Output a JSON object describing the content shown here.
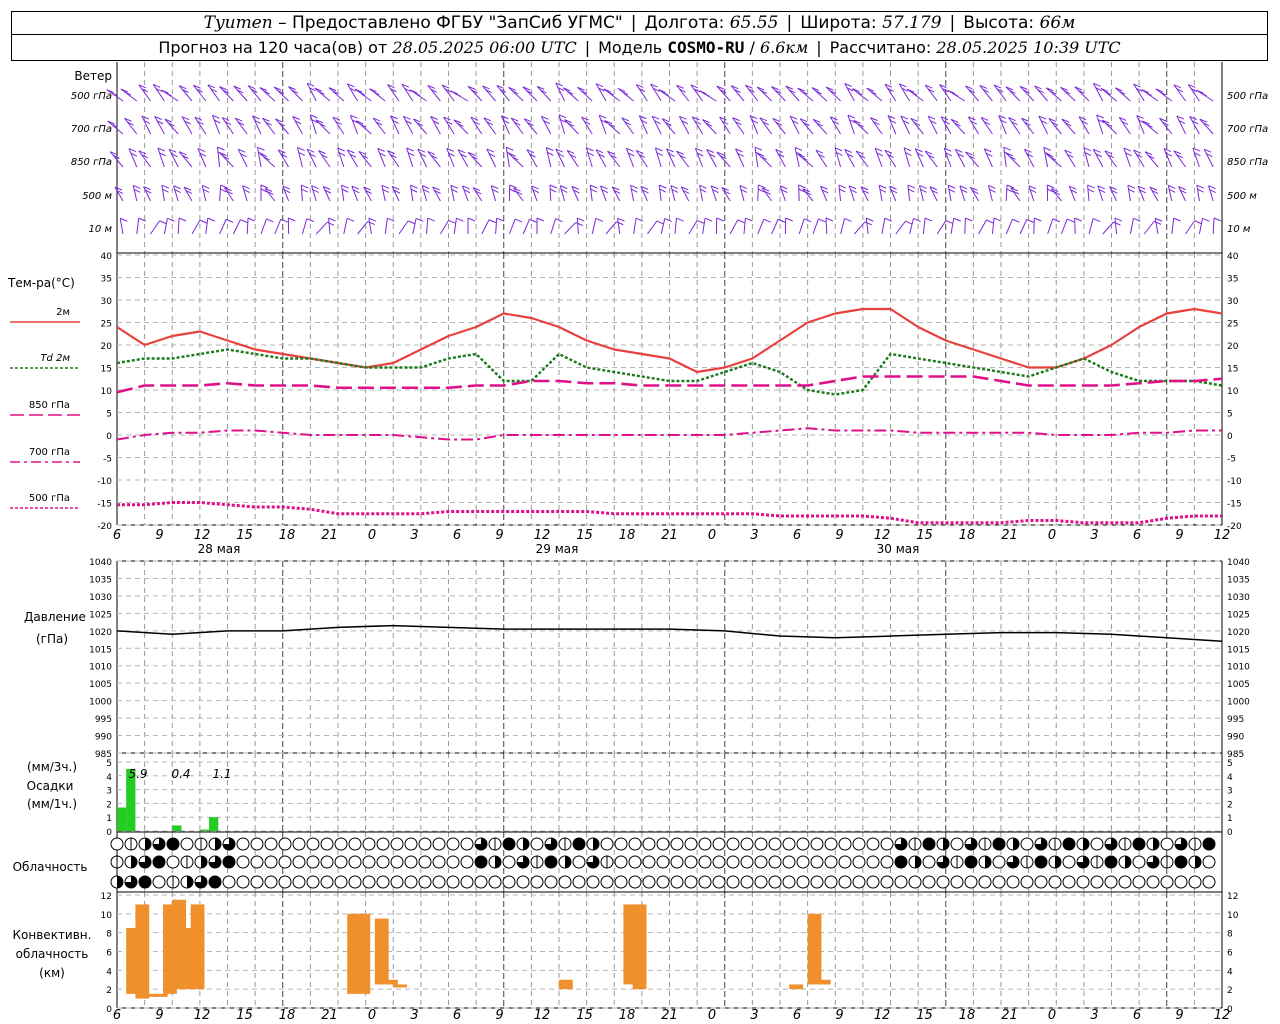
{
  "header": {
    "station": "Tyumen",
    "dash": "–",
    "provider": "Предоставлено ФГБУ \"ЗапСиб УГМС\"",
    "lon_label": "Долгота:",
    "lon": "65.55",
    "lat_label": "Широта:",
    "lat": "57.179",
    "alt_label": "Высота:",
    "alt": "66м",
    "forecast_label": "Прогноз на 120 часа(ов) от",
    "forecast_start": "28.05.2025 06:00 UTC",
    "model_label": "Модель",
    "model": "COSMO-RU",
    "model_res": "6.6км",
    "computed_label": "Рассчитано:",
    "computed": "28.05.2025 10:39 UTC"
  },
  "panels": {
    "wind": {
      "title": "Ветер",
      "levels": [
        "500 гПа",
        "700 гПа",
        "850 гПа",
        "500 м",
        "10 м"
      ],
      "right_levels": [
        "500 гПа",
        "700 гПа",
        "850 гПа",
        "500 м",
        "10 м"
      ]
    },
    "temp": {
      "title": "Тем-ра(°С)",
      "legend": [
        "2м",
        "Td 2м",
        "850 гПа",
        "700 гПа",
        "500 гПа"
      ]
    },
    "pressure": {
      "title1": "Давление",
      "title2": "(гПа)"
    },
    "precip": {
      "title1": "(мм/3ч.)",
      "title2": "Осадки",
      "title3": "(мм/1ч.)",
      "totals": [
        "5.9",
        "0.4",
        "1.1"
      ]
    },
    "cloud": {
      "title": "Облачность"
    },
    "conv": {
      "title1": "Конвективн.",
      "title2": "облачность",
      "title3": "(км)"
    }
  },
  "axis": {
    "hour_labels": [
      "6",
      "9",
      "12",
      "15",
      "18",
      "21",
      "0",
      "3",
      "6",
      "9",
      "12",
      "15",
      "18",
      "21",
      "0",
      "3",
      "6",
      "9",
      "12",
      "15",
      "18",
      "21",
      "0",
      "3",
      "6",
      "9",
      "12"
    ],
    "date_labels": [
      "28 мая",
      "29 мая",
      "30 мая"
    ]
  },
  "colors": {
    "t2m": "#e8413c",
    "td2m": "#1b7a1b",
    "t850": "#e0108a",
    "t700": "#e0108a",
    "t500": "#e0108a",
    "wind": "#7a2ad8",
    "pressure": "#000000",
    "precip": "#22cc22",
    "conv": "#f0902c"
  },
  "chart_data": [
    {
      "type": "line",
      "panel": "temperature",
      "x_hours": [
        0,
        3,
        6,
        9,
        12,
        15,
        18,
        21,
        24,
        27,
        30,
        33,
        36,
        39,
        42,
        45,
        48,
        51,
        54,
        57,
        60,
        63,
        66,
        69,
        72,
        75,
        78,
        81,
        84,
        87,
        90,
        93,
        96,
        99,
        102,
        105,
        108,
        111,
        114,
        117,
        120
      ],
      "series": [
        {
          "name": "2м",
          "values": [
            24,
            20,
            22,
            23,
            21,
            19,
            18,
            17,
            16,
            15,
            16,
            19,
            22,
            24,
            27,
            26,
            24,
            21,
            19,
            18,
            17,
            14,
            15,
            17,
            21,
            25,
            27,
            28,
            28,
            24,
            21,
            19,
            17,
            15,
            15,
            17,
            20,
            24,
            27,
            28,
            27
          ]
        },
        {
          "name": "Td 2м",
          "values": [
            16,
            17,
            17,
            18,
            19,
            18,
            17,
            17,
            16,
            15,
            15,
            15,
            17,
            18,
            12,
            12,
            18,
            15,
            14,
            13,
            12,
            12,
            14,
            16,
            14,
            10,
            9,
            10,
            18,
            17,
            16,
            15,
            14,
            13,
            15,
            17,
            14,
            12,
            12,
            12,
            11
          ]
        },
        {
          "name": "850 гПа",
          "values": [
            9.5,
            11,
            11,
            11,
            11.5,
            11,
            11,
            11,
            10.5,
            10.5,
            10.5,
            10.5,
            10.5,
            11,
            11,
            12,
            12,
            11.5,
            11.5,
            11,
            11,
            11,
            11,
            11,
            11,
            11,
            12,
            13,
            13,
            13,
            13,
            13,
            12,
            11,
            11,
            11,
            11,
            11.5,
            12,
            12,
            12.5
          ]
        },
        {
          "name": "700 гПа",
          "values": [
            -1,
            0,
            0.5,
            0.5,
            1,
            1,
            0.5,
            0,
            0,
            0,
            0,
            -0.5,
            -1,
            -1,
            0,
            0,
            0,
            0,
            0,
            0,
            0,
            0,
            0,
            0.5,
            1,
            1.5,
            1,
            1,
            1,
            0.5,
            0.5,
            0.5,
            0.5,
            0.5,
            0,
            0,
            0,
            0.5,
            0.5,
            1,
            1
          ]
        },
        {
          "name": "500 гПа",
          "values": [
            -15.5,
            -15.5,
            -15,
            -15,
            -15.5,
            -16,
            -16,
            -16.5,
            -17.5,
            -17.5,
            -17.5,
            -17.5,
            -17,
            -17,
            -17,
            -17,
            -17,
            -17,
            -17.5,
            -17.5,
            -17.5,
            -17.5,
            -17.5,
            -17.5,
            -18,
            -18,
            -18,
            -18,
            -18.5,
            -19.5,
            -19.5,
            -19.5,
            -19.5,
            -19,
            -19,
            -19.5,
            -19.5,
            -19.5,
            -18.5,
            -18,
            -18
          ]
        }
      ],
      "ylim": [
        -20,
        40
      ],
      "ylabel": "Тем-ра(°С)"
    },
    {
      "type": "line",
      "panel": "pressure",
      "x_hours": [
        0,
        6,
        12,
        18,
        24,
        30,
        36,
        42,
        48,
        54,
        60,
        66,
        72,
        78,
        84,
        90,
        96,
        102,
        108,
        114,
        120
      ],
      "series": [
        {
          "name": "Давление",
          "values": [
            1020,
            1019,
            1020,
            1020,
            1021,
            1021.5,
            1021,
            1020.5,
            1020.5,
            1020.5,
            1020.5,
            1020,
            1018.5,
            1018,
            1018.5,
            1019,
            1019.5,
            1019.5,
            1019,
            1018,
            1017
          ]
        }
      ],
      "ylim": [
        985,
        1040
      ],
      "ylabel": "Давление (гПа)"
    },
    {
      "type": "bar",
      "panel": "precipitation",
      "x_hours": [
        0,
        1,
        2,
        3,
        6,
        7,
        9,
        10
      ],
      "values": [
        1.7,
        4.5,
        0,
        0,
        0.4,
        0,
        0.1,
        1.0
      ],
      "ylim": [
        0,
        5
      ],
      "ylabel": "Осадки"
    },
    {
      "type": "bar",
      "panel": "convective_cloud",
      "bars": [
        {
          "x": 1,
          "base": 1.5,
          "top": 8.5
        },
        {
          "x": 2,
          "base": 1,
          "top": 11
        },
        {
          "x": 3,
          "base": 1.5,
          "top": 1.5
        },
        {
          "x": 4,
          "base": 1.5,
          "top": 1.5
        },
        {
          "x": 5,
          "base": 1.5,
          "top": 11
        },
        {
          "x": 6,
          "base": 2,
          "top": 11.5
        },
        {
          "x": 7,
          "base": 2,
          "top": 8.5
        },
        {
          "x": 8,
          "base": 2,
          "top": 11
        },
        {
          "x": 25,
          "base": 1.5,
          "top": 10
        },
        {
          "x": 26,
          "base": 1.5,
          "top": 10
        },
        {
          "x": 28,
          "base": 2.5,
          "top": 9.5
        },
        {
          "x": 29,
          "base": 2.5,
          "top": 3
        },
        {
          "x": 30,
          "base": 2.5,
          "top": 2.5
        },
        {
          "x": 48,
          "base": 2,
          "top": 3
        },
        {
          "x": 55,
          "base": 2.5,
          "top": 11
        },
        {
          "x": 56,
          "base": 2,
          "top": 11
        },
        {
          "x": 73,
          "base": 2,
          "top": 2.5
        },
        {
          "x": 75,
          "base": 2.5,
          "top": 10
        },
        {
          "x": 76,
          "base": 2.5,
          "top": 3
        }
      ],
      "ylim": [
        0,
        12
      ],
      "ylabel": "Конвективн. облачность (км)"
    }
  ]
}
